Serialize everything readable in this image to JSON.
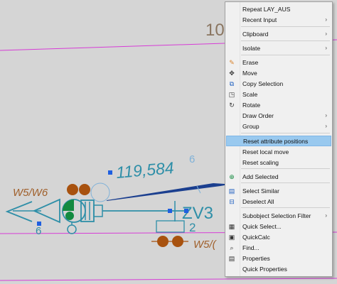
{
  "drawing": {
    "label_10": "10",
    "label_6": "6",
    "dimension_value": "119,584",
    "label_w5w6": "W5/W6",
    "label_6_small": "6",
    "label_zv3": "ZV3",
    "label_2": "2",
    "label_w5_partial": "W5/("
  },
  "menu": {
    "items": [
      {
        "label": "Repeat LAY_AUS",
        "icon": "",
        "submenu": false,
        "highlighted": false
      },
      {
        "label": "Recent Input",
        "icon": "",
        "submenu": true,
        "highlighted": false
      },
      {
        "label": "Clipboard",
        "icon": "",
        "submenu": true,
        "highlighted": false
      },
      {
        "label": "Isolate",
        "icon": "",
        "submenu": true,
        "highlighted": false
      },
      {
        "label": "Erase",
        "icon": "eraser-icon",
        "submenu": false,
        "highlighted": false
      },
      {
        "label": "Move",
        "icon": "move-icon",
        "submenu": false,
        "highlighted": false
      },
      {
        "label": "Copy Selection",
        "icon": "copy-icon",
        "submenu": false,
        "highlighted": false
      },
      {
        "label": "Scale",
        "icon": "scale-icon",
        "submenu": false,
        "highlighted": false
      },
      {
        "label": "Rotate",
        "icon": "rotate-icon",
        "submenu": false,
        "highlighted": false
      },
      {
        "label": "Draw Order",
        "icon": "",
        "submenu": true,
        "highlighted": false
      },
      {
        "label": "Group",
        "icon": "",
        "submenu": true,
        "highlighted": false
      },
      {
        "label": "Reset attribute positions",
        "icon": "",
        "submenu": false,
        "highlighted": true
      },
      {
        "label": "Reset local move",
        "icon": "",
        "submenu": false,
        "highlighted": false
      },
      {
        "label": "Reset scaling",
        "icon": "",
        "submenu": false,
        "highlighted": false
      },
      {
        "label": "Add Selected",
        "icon": "add-selected-icon",
        "submenu": false,
        "highlighted": false
      },
      {
        "label": "Select Similar",
        "icon": "select-similar-icon",
        "submenu": false,
        "highlighted": false
      },
      {
        "label": "Deselect All",
        "icon": "deselect-all-icon",
        "submenu": false,
        "highlighted": false
      },
      {
        "label": "Subobject Selection Filter",
        "icon": "",
        "submenu": true,
        "highlighted": false
      },
      {
        "label": "Quick Select...",
        "icon": "quick-select-icon",
        "submenu": false,
        "highlighted": false
      },
      {
        "label": "QuickCalc",
        "icon": "calculator-icon",
        "submenu": false,
        "highlighted": false
      },
      {
        "label": "Find...",
        "icon": "find-icon",
        "submenu": false,
        "highlighted": false
      },
      {
        "label": "Properties",
        "icon": "properties-icon",
        "submenu": false,
        "highlighted": false
      },
      {
        "label": "Quick Properties",
        "icon": "",
        "submenu": false,
        "highlighted": false
      }
    ]
  },
  "colors": {
    "canvas_bg": "#d5d5d5",
    "cyan_lines": "#2f8fa8",
    "magenta_lines": "#d63cd6",
    "dark_blue_line": "#1b3f8f",
    "brown_circles": "#a8520f",
    "green_fill": "#138a3f",
    "grip_blue": "#1f5fe0",
    "highlight": "#99c9ef"
  }
}
